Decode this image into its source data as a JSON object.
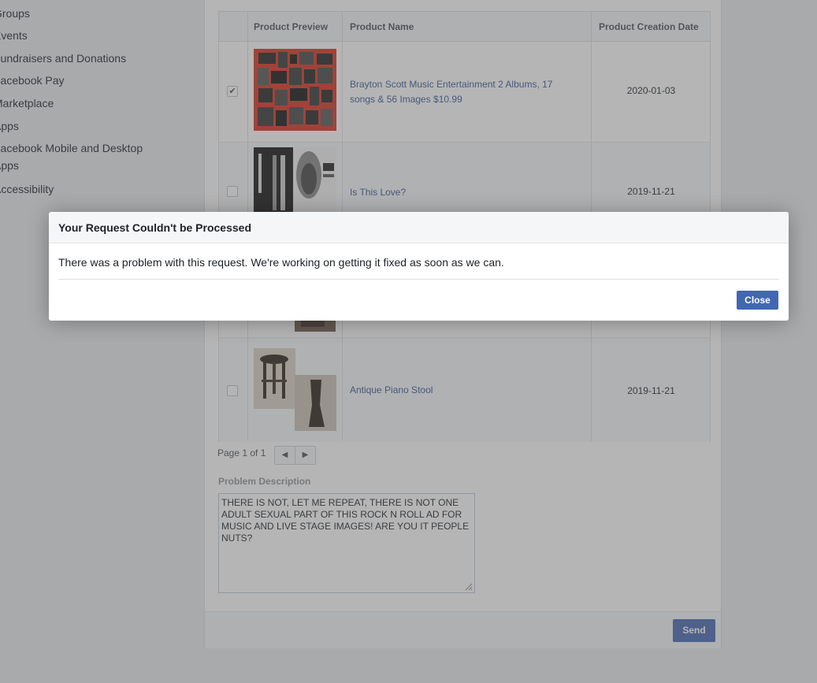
{
  "sidebar": {
    "items": [
      {
        "label": "Groups"
      },
      {
        "label": "Events"
      },
      {
        "label": "Fundraisers and Donations"
      },
      {
        "label": "Facebook Pay"
      },
      {
        "label": "Marketplace"
      },
      {
        "label": "Apps"
      },
      {
        "label": "Facebook Mobile and Desktop Apps"
      },
      {
        "label": "Accessibility"
      }
    ]
  },
  "table": {
    "headers": {
      "preview": "Product Preview",
      "name": "Product Name",
      "date": "Product Creation Date"
    },
    "rows": [
      {
        "name": "Brayton Scott Music Entertainment 2 Albums, 17 songs & 56 Images $10.99",
        "date": "2020-01-03",
        "checked": true
      },
      {
        "name": "Is This Love?",
        "date": "2019-11-21",
        "checked": false
      },
      {
        "name": "",
        "date": "",
        "checked": false
      },
      {
        "name": "Antique Piano Stool",
        "date": "2019-11-21",
        "checked": false
      }
    ]
  },
  "pager": {
    "text": "Page 1 of 1",
    "prev_icon": "◀",
    "next_icon": "▶"
  },
  "problem": {
    "label": "Problem Description",
    "text": "THERE IS NOT, LET ME REPEAT, THERE IS NOT ONE ADULT SEXUAL PART OF THIS ROCK N ROLL AD FOR MUSIC AND LIVE STAGE IMAGES! ARE YOU IT PEOPLE NUTS?"
  },
  "footer": {
    "send_label": "Send"
  },
  "dialog": {
    "title": "Your Request Couldn't be Processed",
    "message": "There was a problem with this request. We're working on getting it fixed as soon as we can.",
    "close_label": "Close"
  },
  "checkmark_glyph": "✔",
  "colors": {
    "link": "#385898",
    "button": "#4267b2",
    "overlay": "rgba(90,90,90,0.45)"
  }
}
